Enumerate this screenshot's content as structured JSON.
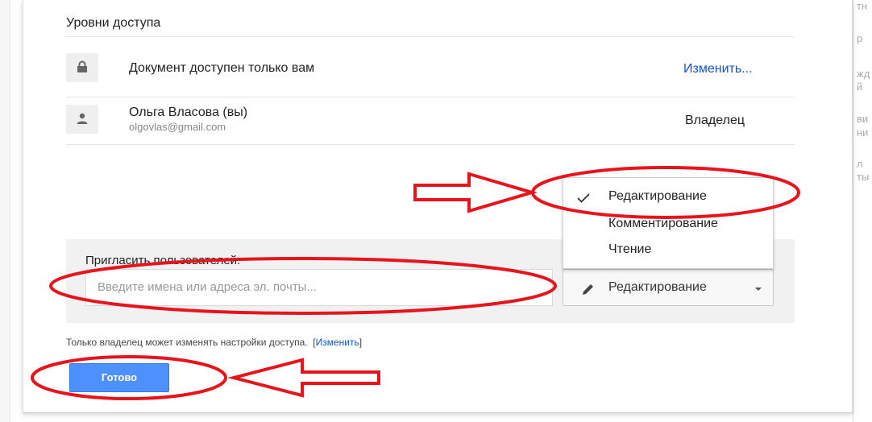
{
  "background": {
    "right_fragments": [
      "тн",
      "р",
      "жд",
      "й",
      "ви",
      "ни",
      "л",
      "ты"
    ]
  },
  "dialog": {
    "section_title": "Уровни доступа",
    "rows": [
      {
        "icon": "lock-icon",
        "text": "Документ доступен только вам",
        "action_label": "Изменить..."
      },
      {
        "icon": "person-icon",
        "name": "Ольга Власова (вы)",
        "email": "olgovlas@gmail.com",
        "role": "Владелец"
      }
    ],
    "permission_menu": {
      "items": [
        "Редактирование",
        "Комментирование",
        "Чтение"
      ],
      "selected": "Редактирование"
    },
    "invite": {
      "label": "Пригласить пользователей:",
      "placeholder": "Введите имена или адреса эл. почты...",
      "permission_value": "Редактирование"
    },
    "footer": {
      "note": "Только владелец может изменять настройки доступа.",
      "bracket_open": "[",
      "change_link": "Изменить",
      "bracket_close": "]"
    },
    "done_label": "Готово"
  },
  "colors": {
    "accent_blue": "#4d90fe",
    "link_blue": "#1155cc",
    "annotation_red": "#e8141c"
  }
}
